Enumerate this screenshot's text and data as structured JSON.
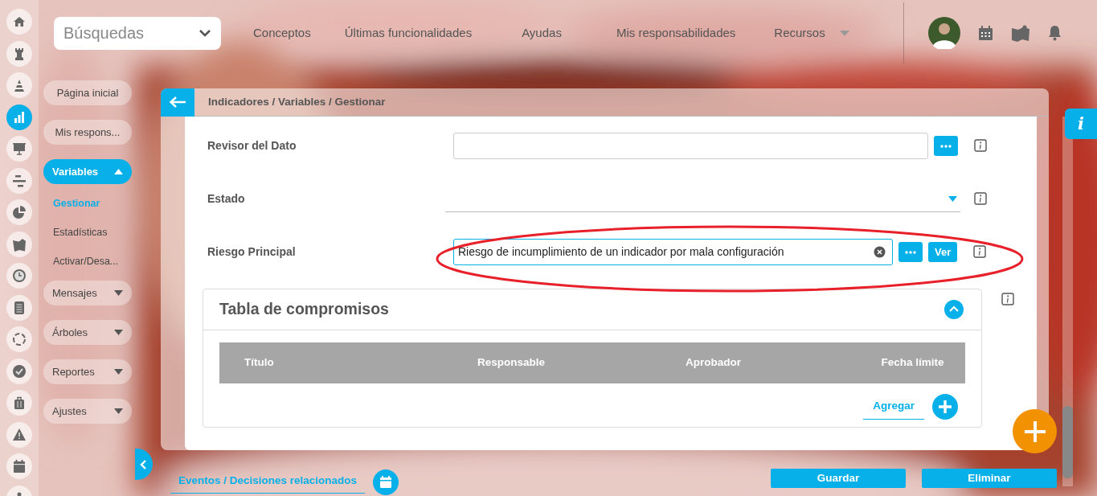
{
  "rail": [
    {
      "kind": "home",
      "selected": false
    },
    {
      "kind": "rook",
      "selected": false
    },
    {
      "kind": "cone",
      "selected": false
    },
    {
      "kind": "chart",
      "selected": true
    },
    {
      "kind": "easel",
      "selected": false
    },
    {
      "kind": "bars",
      "selected": false
    },
    {
      "kind": "pie",
      "selected": false
    },
    {
      "kind": "board",
      "selected": false
    },
    {
      "kind": "clock",
      "selected": false
    },
    {
      "kind": "list",
      "selected": false
    },
    {
      "kind": "cycle",
      "selected": false
    },
    {
      "kind": "check",
      "selected": false
    },
    {
      "kind": "case",
      "selected": false
    },
    {
      "kind": "warning",
      "selected": false
    },
    {
      "kind": "calendar",
      "selected": false
    },
    {
      "kind": "network",
      "selected": false
    }
  ],
  "search": {
    "value": "Búsquedas"
  },
  "top_nav": [
    {
      "label": "Conceptos",
      "dropdown": false
    },
    {
      "label": "Últimas funcionalidades",
      "dropdown": false
    },
    {
      "label": "Ayudas",
      "dropdown": false
    },
    {
      "label": "Mis responsabilidades",
      "dropdown": false
    },
    {
      "label": "Recursos",
      "dropdown": true
    }
  ],
  "sidebar": {
    "items": [
      {
        "label": "Página inicial",
        "kind": "link"
      },
      {
        "label": "Mis respons...",
        "kind": "link"
      },
      {
        "label": "Variables",
        "kind": "group",
        "expanded": true,
        "children": [
          {
            "label": "Gestionar",
            "selected": true
          },
          {
            "label": "Estadísticas",
            "selected": false
          },
          {
            "label": "Activar/Desa...",
            "selected": false
          }
        ]
      },
      {
        "label": "Mensajes",
        "kind": "group",
        "expanded": false
      },
      {
        "label": "Árboles",
        "kind": "group",
        "expanded": false
      },
      {
        "label": "Reportes",
        "kind": "group",
        "expanded": false
      },
      {
        "label": "Ajustes",
        "kind": "group",
        "expanded": false
      }
    ]
  },
  "breadcrumb": "Indicadores / Variables / Gestionar",
  "fields": [
    {
      "label": "Revisor del Dato",
      "kind": "lookup"
    },
    {
      "label": "Estado",
      "kind": "select"
    },
    {
      "label": "Riesgo Principal",
      "kind": "lookup",
      "value": "Riesgo de incumplimiento de un indicador por mala configuración",
      "clearable": true,
      "view_button": "Ver",
      "highlighted": true
    }
  ],
  "commitments": {
    "title": "Tabla de compromisos",
    "expanded": true,
    "columns": [
      "Título",
      "Responsable",
      "Aprobador",
      "Fecha límite"
    ],
    "add_label": "Agregar"
  },
  "related_link": "Eventos / Decisiones relacionados",
  "actions": [
    "Guardar",
    "Eliminar"
  ],
  "info_tab": "i"
}
